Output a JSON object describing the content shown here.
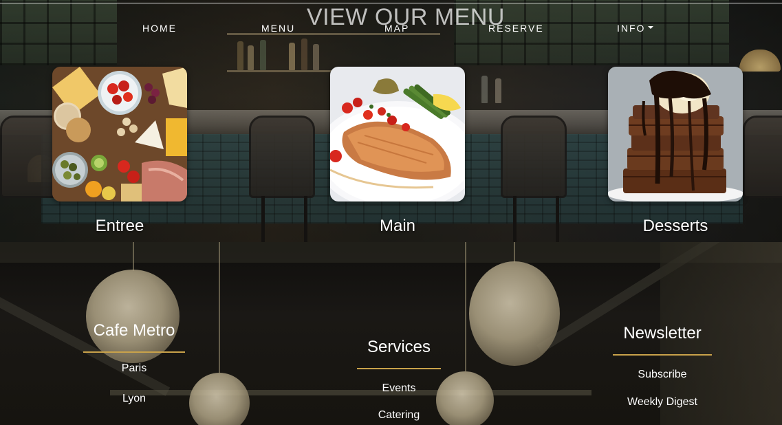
{
  "nav": {
    "home": "HOME",
    "menu": "MENU",
    "map": "MAP",
    "reserve": "RESERVE",
    "info": "INFO"
  },
  "menu_section": {
    "heading": "VIEW OUR MENU",
    "cards": [
      {
        "label": "Entree"
      },
      {
        "label": "Main"
      },
      {
        "label": "Desserts"
      }
    ]
  },
  "footer": {
    "columns": [
      {
        "title": "Cafe Metro",
        "links": [
          "Paris",
          "Lyon"
        ]
      },
      {
        "title": "Services",
        "links": [
          "Events",
          "Catering"
        ]
      },
      {
        "title": "Newsletter",
        "links": [
          "Subscribe",
          "Weekly Digest"
        ]
      }
    ]
  },
  "colors": {
    "accent_rule": "#c9a24a",
    "text": "#ffffff",
    "footer_bg": "#141210"
  }
}
